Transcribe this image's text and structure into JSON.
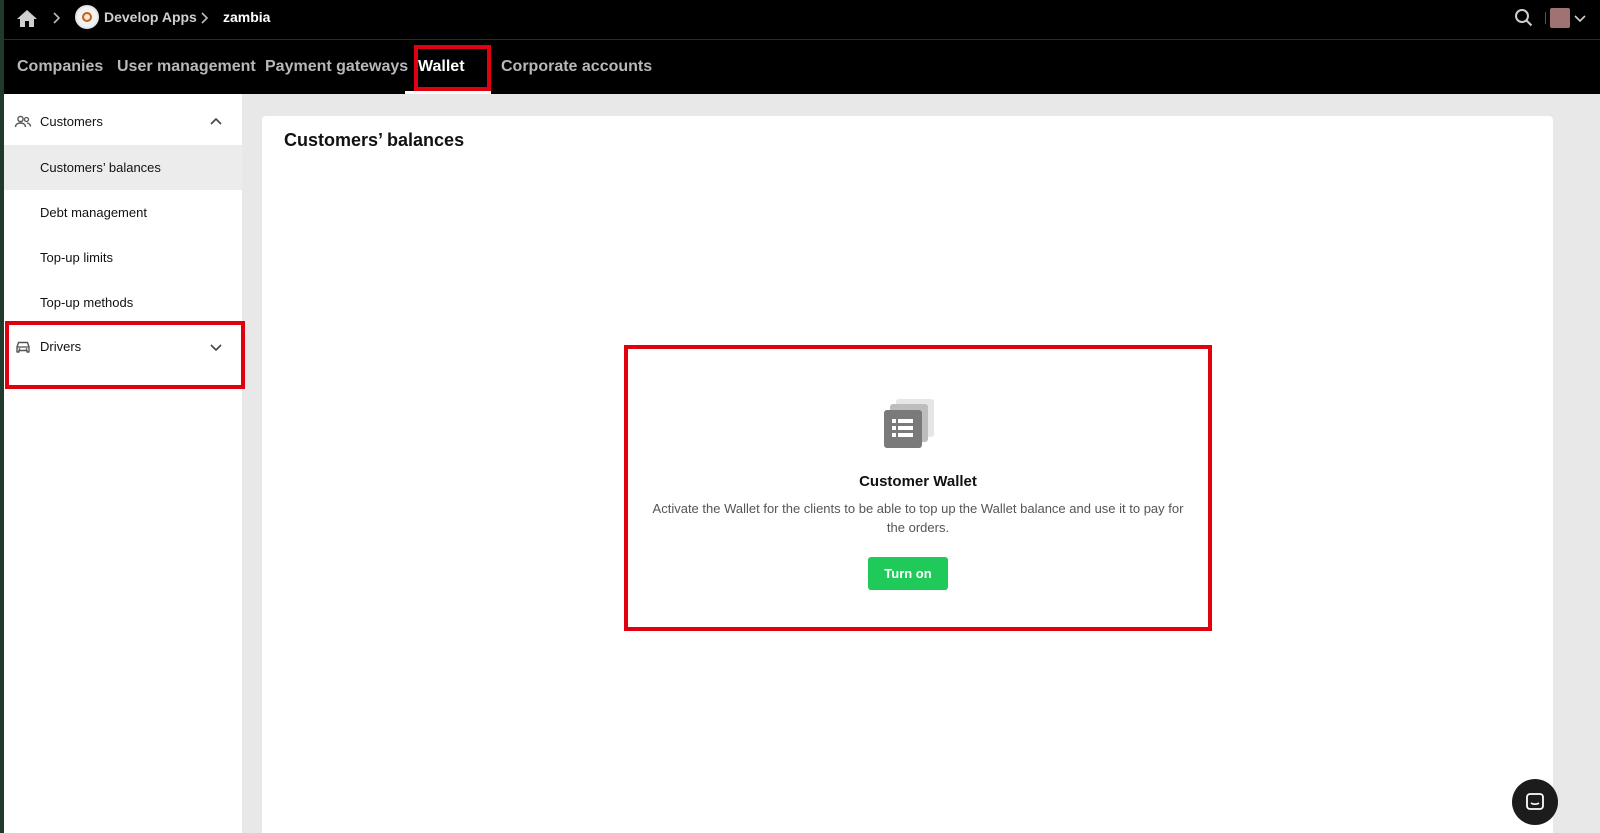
{
  "breadcrumb": {
    "home_icon": "home-icon",
    "app_name": "Develop Apps",
    "current": "zambia"
  },
  "header": {
    "search_icon": "search-icon",
    "avatar_color": "#a07373"
  },
  "nav": {
    "tabs": [
      {
        "label": "Companies"
      },
      {
        "label": "User management"
      },
      {
        "label": "Payment gateways"
      },
      {
        "label": "Wallet",
        "active": true
      },
      {
        "label": "Corporate accounts"
      }
    ]
  },
  "sidebar": {
    "groups": [
      {
        "label": "Customers",
        "icon": "users-icon",
        "expanded": true,
        "items": [
          {
            "label": "Customers’ balances",
            "selected": true
          },
          {
            "label": "Debt management"
          },
          {
            "label": "Top-up limits"
          },
          {
            "label": "Top-up methods"
          }
        ]
      },
      {
        "label": "Drivers",
        "icon": "car-icon",
        "expanded": false
      }
    ]
  },
  "main": {
    "title": "Customers’ balances",
    "empty_state": {
      "icon": "wallet-list-icon",
      "title": "Customer Wallet",
      "description": "Activate the Wallet for the clients to be able to top up the Wallet balance and use it to pay for the orders.",
      "button_label": "Turn on"
    }
  },
  "colors": {
    "accent_green": "#1fca5a",
    "highlight_red": "#e0000f",
    "topbar": "#000000"
  }
}
